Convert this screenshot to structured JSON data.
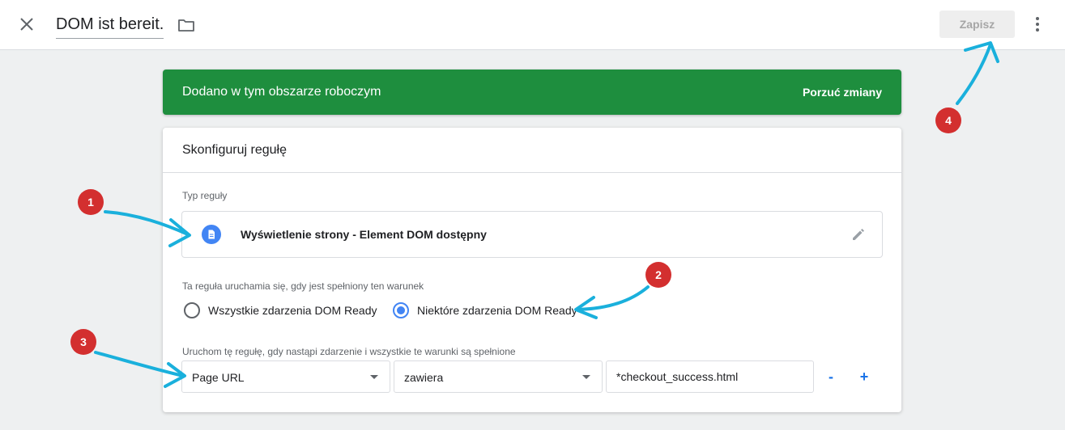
{
  "header": {
    "title": "DOM ist bereit.",
    "save_label": "Zapisz"
  },
  "banner": {
    "text": "Dodano w tym obszarze roboczym",
    "discard_label": "Porzuć zmiany",
    "color": "#1e8e3e"
  },
  "card": {
    "title": "Skonfiguruj regułę",
    "trigger_type": {
      "label": "Typ reguły",
      "name": "Wyświetlenie strony - Element DOM dostępny",
      "icon": "document-icon"
    },
    "fires_on": {
      "label": "Ta reguła uruchamia się, gdy jest spełniony ten warunek",
      "options": [
        {
          "label": "Wszystkie zdarzenia DOM Ready",
          "selected": false
        },
        {
          "label": "Niektóre zdarzenia DOM Ready",
          "selected": true
        }
      ]
    },
    "condition": {
      "label": "Uruchom tę regułę, gdy nastąpi zdarzenie i wszystkie te warunki są spełnione",
      "variable": "Page URL",
      "operator": "zawiera",
      "value": "*checkout_success.html",
      "remove_label": "-",
      "add_label": "+"
    }
  },
  "annotations": {
    "badges": [
      "1",
      "2",
      "3",
      "4"
    ],
    "badge_color": "#d32f2f",
    "arrow_color": "#1ab0dc"
  },
  "colors": {
    "accent": "#4285f4",
    "link": "#1a73e8"
  }
}
